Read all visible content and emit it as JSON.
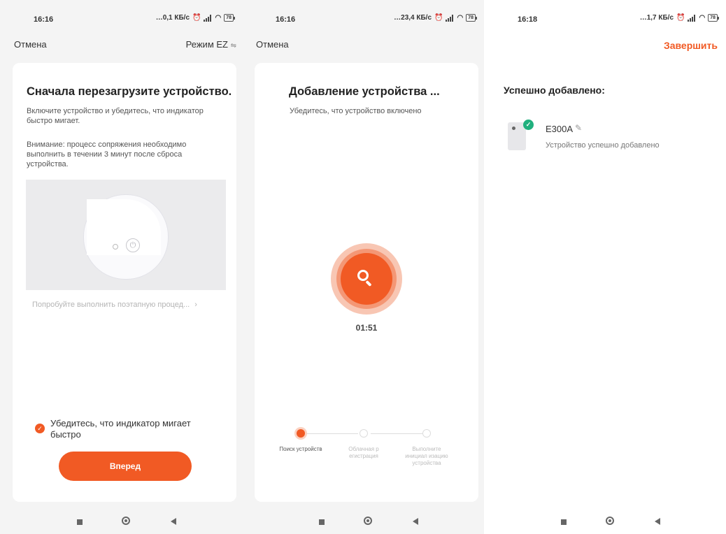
{
  "colors": {
    "accent": "#f15a24",
    "success": "#21b07e",
    "background": "#f4f4f4"
  },
  "screen1": {
    "status": {
      "time": "16:16",
      "net": "…0,1 КБ/с",
      "battery": "78"
    },
    "cancel": "Отмена",
    "mode": "Режим EZ",
    "title": "Сначала перезагрузите устройство.",
    "desc": "Включите устройство и убедитесь, что индикатор быстро мигает.",
    "warning": "Внимание: процесс сопряжения необходимо выполнить в течении 3 минут после сброса устройства.",
    "try_link": "Попробуйте выполнить поэтапную процед...",
    "checkbox_label": "Убедитесь, что индикатор мигает быстро",
    "next_button": "Вперед"
  },
  "screen2": {
    "status": {
      "time": "16:16",
      "net": "…23,4 КБ/с",
      "battery": "78"
    },
    "cancel": "Отмена",
    "title": "Добавление устройства ...",
    "subtitle": "Убедитесь, что устройство включено",
    "timer": "01:51",
    "steps": [
      {
        "label": "Поиск устройств",
        "state": "active"
      },
      {
        "label": "Облачная р егистрация",
        "state": "pending"
      },
      {
        "label": "Выполните инициал изацию устройства",
        "state": "pending"
      }
    ]
  },
  "screen3": {
    "status": {
      "time": "16:18",
      "net": "…1,7 КБ/с",
      "battery": "78"
    },
    "done": "Завершить",
    "success_title": "Успешно добавлено:",
    "device": {
      "name": "E300A",
      "status": "Устройство успешно добавлено"
    }
  }
}
